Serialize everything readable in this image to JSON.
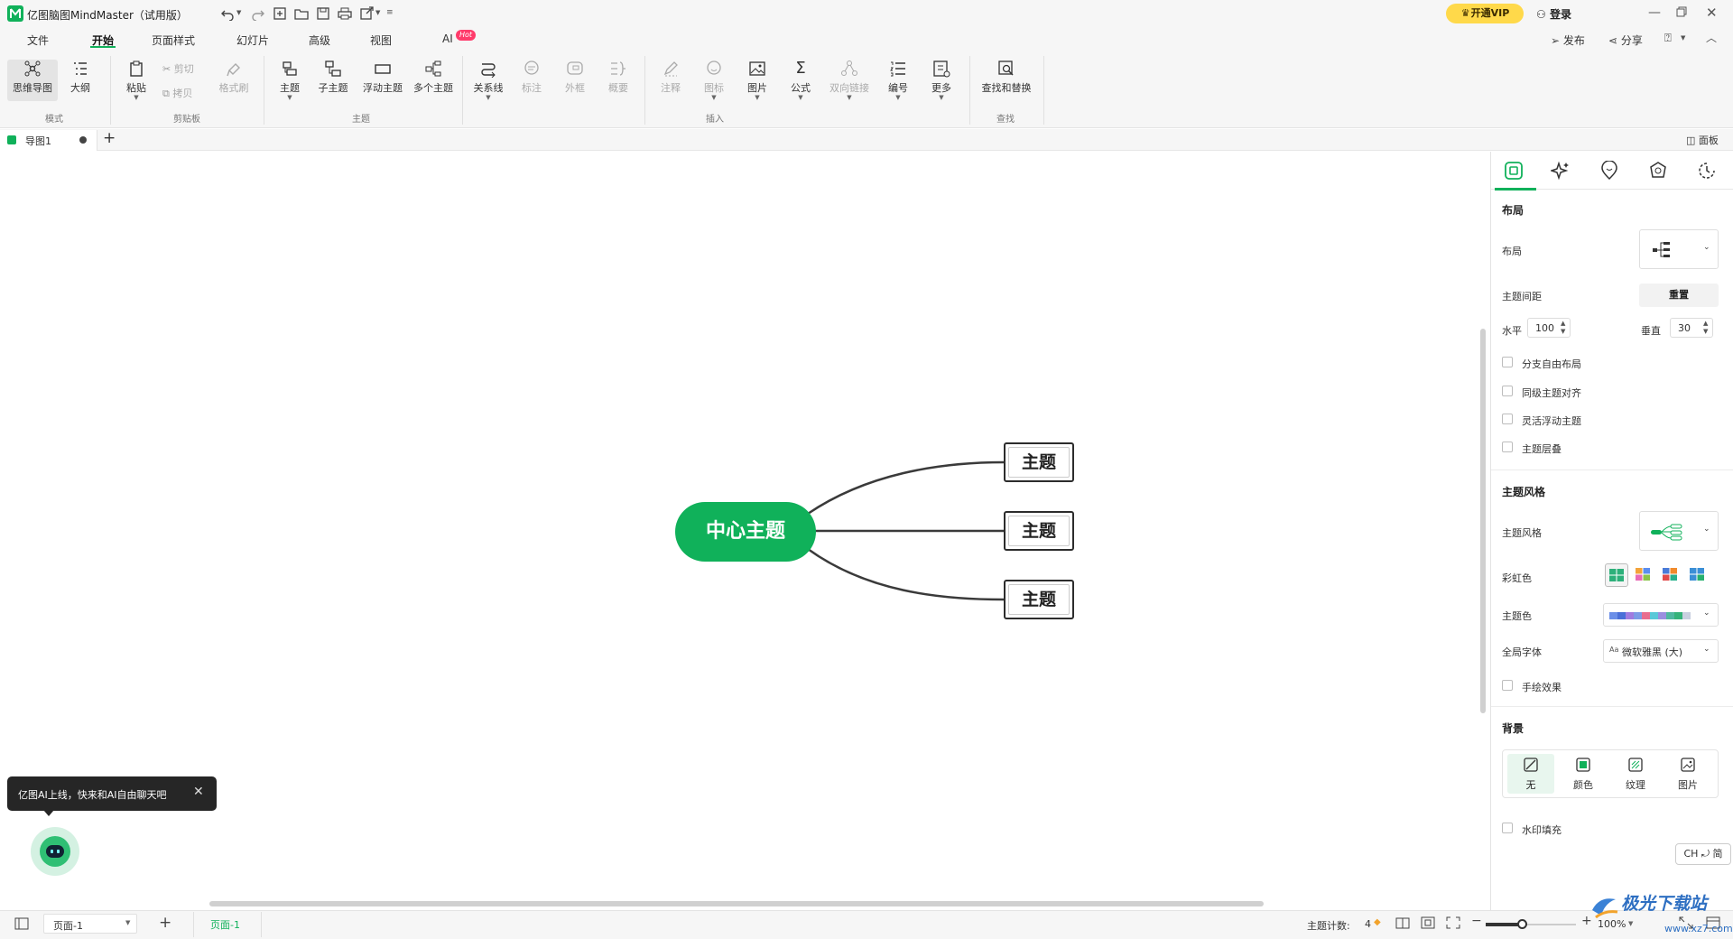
{
  "titlebar": {
    "app_title": "亿图脑图MindMaster（试用版）",
    "vip_button": "开通VIP",
    "login_button": "登录"
  },
  "menubar": {
    "tabs": [
      "文件",
      "开始",
      "页面样式",
      "幻灯片",
      "高级",
      "视图",
      "AI"
    ],
    "active_tab": "开始",
    "ai_badge": "Hot",
    "publish": "发布",
    "share": "分享"
  },
  "ribbon": {
    "mode": {
      "label": "模式",
      "mindmap": "思维导图",
      "outline": "大纲"
    },
    "clipboard": {
      "label": "剪贴板",
      "paste": "粘贴",
      "cut": "剪切",
      "copy": "拷贝",
      "format_painter": "格式刷"
    },
    "topic": {
      "label": "主题",
      "topic": "主题",
      "subtopic": "子主题",
      "floating": "浮动主题",
      "multiple": "多个主题"
    },
    "insert": {
      "label": "插入",
      "relation": "关系线",
      "callout": "标注",
      "boundary": "外框",
      "summary": "概要",
      "note": "注释",
      "icon": "图标",
      "image": "图片",
      "formula": "公式",
      "hyperlink": "双向链接",
      "numbering": "编号",
      "more": "更多"
    },
    "find": {
      "label": "查找",
      "find_replace": "查找和替换"
    }
  },
  "doc_tabs": {
    "tab1": "导图1",
    "panel_toggle": "面板"
  },
  "mindmap": {
    "central": "中心主题",
    "topics": [
      "主题",
      "主题",
      "主题"
    ],
    "central_color": "#10b15a"
  },
  "ai_tooltip": {
    "text": "亿图AI上线，快来和AI自由聊天吧"
  },
  "right_panel": {
    "layout_section": "布局",
    "layout_label": "布局",
    "spacing_label": "主题间距",
    "reset_button": "重置",
    "horizontal_label": "水平",
    "horizontal_value": "100",
    "vertical_label": "垂直",
    "vertical_value": "30",
    "checkboxes": [
      "分支自由布局",
      "同级主题对齐",
      "灵活浮动主题",
      "主题层叠"
    ],
    "style_section": "主题风格",
    "style_label": "主题风格",
    "rainbow_label": "彩虹色",
    "theme_color_label": "主题色",
    "font_label": "全局字体",
    "font_value": "微软雅黑 (大)",
    "handdrawn_label": "手绘效果",
    "background_section": "背景",
    "bg_options": [
      "无",
      "颜色",
      "纹理",
      "图片"
    ],
    "watermark_label": "水印填充",
    "ime_indicator": "CH ⤾ 简"
  },
  "statusbar": {
    "page_select": "页面-1",
    "page_tab": "页面-1",
    "topic_count_label": "主题计数:",
    "topic_count_value": "4",
    "zoom_value": "100%"
  },
  "watermark": "极光下载站",
  "watermark_sub": "www.xz7.com",
  "colors": {
    "accent": "#10b15a",
    "vip": "#ffd94a",
    "hot": "#ff3b6b"
  }
}
